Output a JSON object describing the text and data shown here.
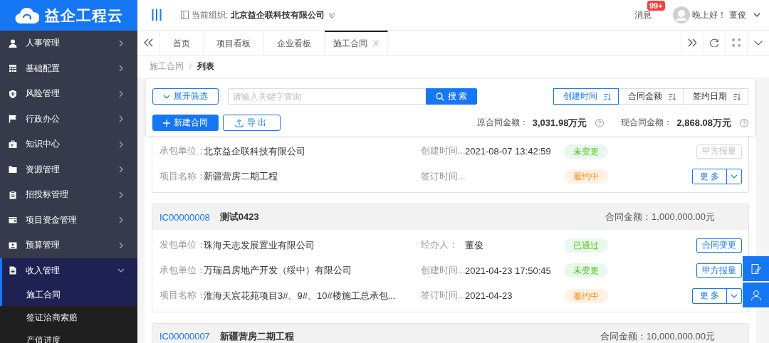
{
  "logo": {
    "text": "益企工程云"
  },
  "header": {
    "org_label": "当前组织:",
    "org_name": "北京益企联科技有限公司",
    "messages_label": "消息",
    "badge": "99+",
    "greeting": "晚上好！",
    "user": "董俊"
  },
  "sidebar": {
    "items": [
      {
        "label": "人事管理",
        "expanded": false
      },
      {
        "label": "基础配置",
        "expanded": false
      },
      {
        "label": "风险管理",
        "expanded": false
      },
      {
        "label": "行政办公",
        "expanded": false
      },
      {
        "label": "知识中心",
        "expanded": false
      },
      {
        "label": "资源管理",
        "expanded": false
      },
      {
        "label": "招投标管理",
        "expanded": false
      },
      {
        "label": "项目资金管理",
        "expanded": false
      },
      {
        "label": "预算管理",
        "expanded": false
      },
      {
        "label": "收入管理",
        "expanded": true,
        "children": [
          {
            "label": "施工合同",
            "selected": true
          },
          {
            "label": "签证洽商索赔",
            "selected": false
          },
          {
            "label": "产值进度",
            "selected": false
          }
        ]
      }
    ]
  },
  "tabs": [
    {
      "label": "首页",
      "selected": false
    },
    {
      "label": "项目看板",
      "selected": false
    },
    {
      "label": "企业看板",
      "selected": false
    },
    {
      "label": "施工合同",
      "selected": true
    }
  ],
  "breadcrumb": {
    "separator": "/",
    "items": [
      "施工合同",
      "列表"
    ]
  },
  "toolbar": {
    "filter_button": "展开筛选",
    "search": {
      "placeholder": "请输入关键字查询"
    },
    "search_button": "搜 索",
    "sorts": [
      {
        "label": "创建时间",
        "selected": true
      },
      {
        "label": "合同金额",
        "selected": false
      },
      {
        "label": "签约日期",
        "selected": false
      }
    ],
    "new_button": "新建合同",
    "export_button": "导出",
    "totals": [
      {
        "label": "原合同金额：",
        "value": "3,031.98万元"
      },
      {
        "label": "现合同金额：",
        "value": "2,868.08万元"
      }
    ]
  },
  "contracts": [
    {
      "rows": [
        {
          "left": {
            "label": "承包单位：",
            "value": "北京益企联科技有限公司"
          },
          "middle": {
            "label": "创建时间...",
            "value": "2021-08-07 13:42:59"
          },
          "status": {
            "label": "未变更",
            "kind": "success"
          },
          "action": {
            "label": "甲方报量",
            "kind": "button",
            "disabled": true
          }
        },
        {
          "left": {
            "label": "项目名称：",
            "value": "新疆营房二期工程"
          },
          "middle": {
            "label": "签订时间..."
          },
          "status": {
            "label": "履约中",
            "kind": "warning"
          },
          "action": {
            "label": "更 多",
            "kind": "split",
            "disabled": false
          }
        }
      ]
    },
    {
      "code": "IC00000008",
      "name": "测试0423",
      "amount_label": "合同金额：",
      "amount": "1,000,000.00元",
      "rows": [
        {
          "left": {
            "label": "发包单位：",
            "value": "珠海天志发展置业有限公司"
          },
          "middle": {
            "label": "经办人：",
            "value": "董俊"
          },
          "status": {
            "label": "已通过",
            "kind": "success"
          },
          "action": {
            "label": "合同变更",
            "kind": "button",
            "disabled": false
          }
        },
        {
          "left": {
            "label": "承包单位：",
            "value": "万瑞昌房地产开发（绥中）有限公司"
          },
          "middle": {
            "label": "创建时间...",
            "value": "2021-04-23 17:50:45"
          },
          "status": {
            "label": "未变更",
            "kind": "success"
          },
          "action": {
            "label": "甲方报量",
            "kind": "button",
            "disabled": false
          }
        },
        {
          "left": {
            "label": "项目名称：",
            "value": "淮海天宸花苑项目3#、9#、10#楼施工总承包..."
          },
          "middle": {
            "label": "签订时间...",
            "value": "2021-04-23"
          },
          "status": {
            "label": "履约中",
            "kind": "warning"
          },
          "action": {
            "label": "更 多",
            "kind": "split",
            "disabled": false
          }
        }
      ]
    },
    {
      "code": "IC00000007",
      "name": "新疆营房二期工程",
      "amount_label": "合同金额：",
      "amount": "10,000,000.00元"
    }
  ]
}
